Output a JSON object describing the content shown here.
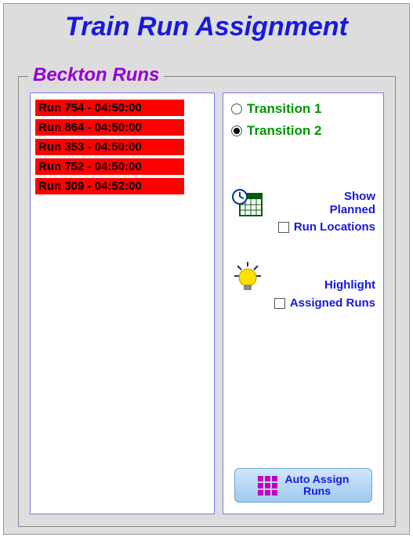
{
  "title": "Train Run Assignment",
  "group": {
    "title": "Beckton Runs"
  },
  "runs": [
    {
      "label": "Run 754 - 04:50:00"
    },
    {
      "label": "Run 864 - 04:50:00"
    },
    {
      "label": "Run 353 - 04:50:00"
    },
    {
      "label": "Run 752 - 04:50:00"
    },
    {
      "label": "Run 309 - 04:52:00"
    }
  ],
  "transitions": {
    "option1": "Transition 1",
    "option2": "Transition 2",
    "selected": "option2"
  },
  "options": {
    "show_planned_label_l1": "Show",
    "show_planned_label_l2": "Planned",
    "show_planned_label_l3": "Run Locations",
    "show_planned_checked": false,
    "highlight_label_l1": "Highlight",
    "highlight_label_l2": "Assigned Runs",
    "highlight_checked": false
  },
  "auto_assign": {
    "label_l1": "Auto Assign",
    "label_l2": "Runs"
  }
}
